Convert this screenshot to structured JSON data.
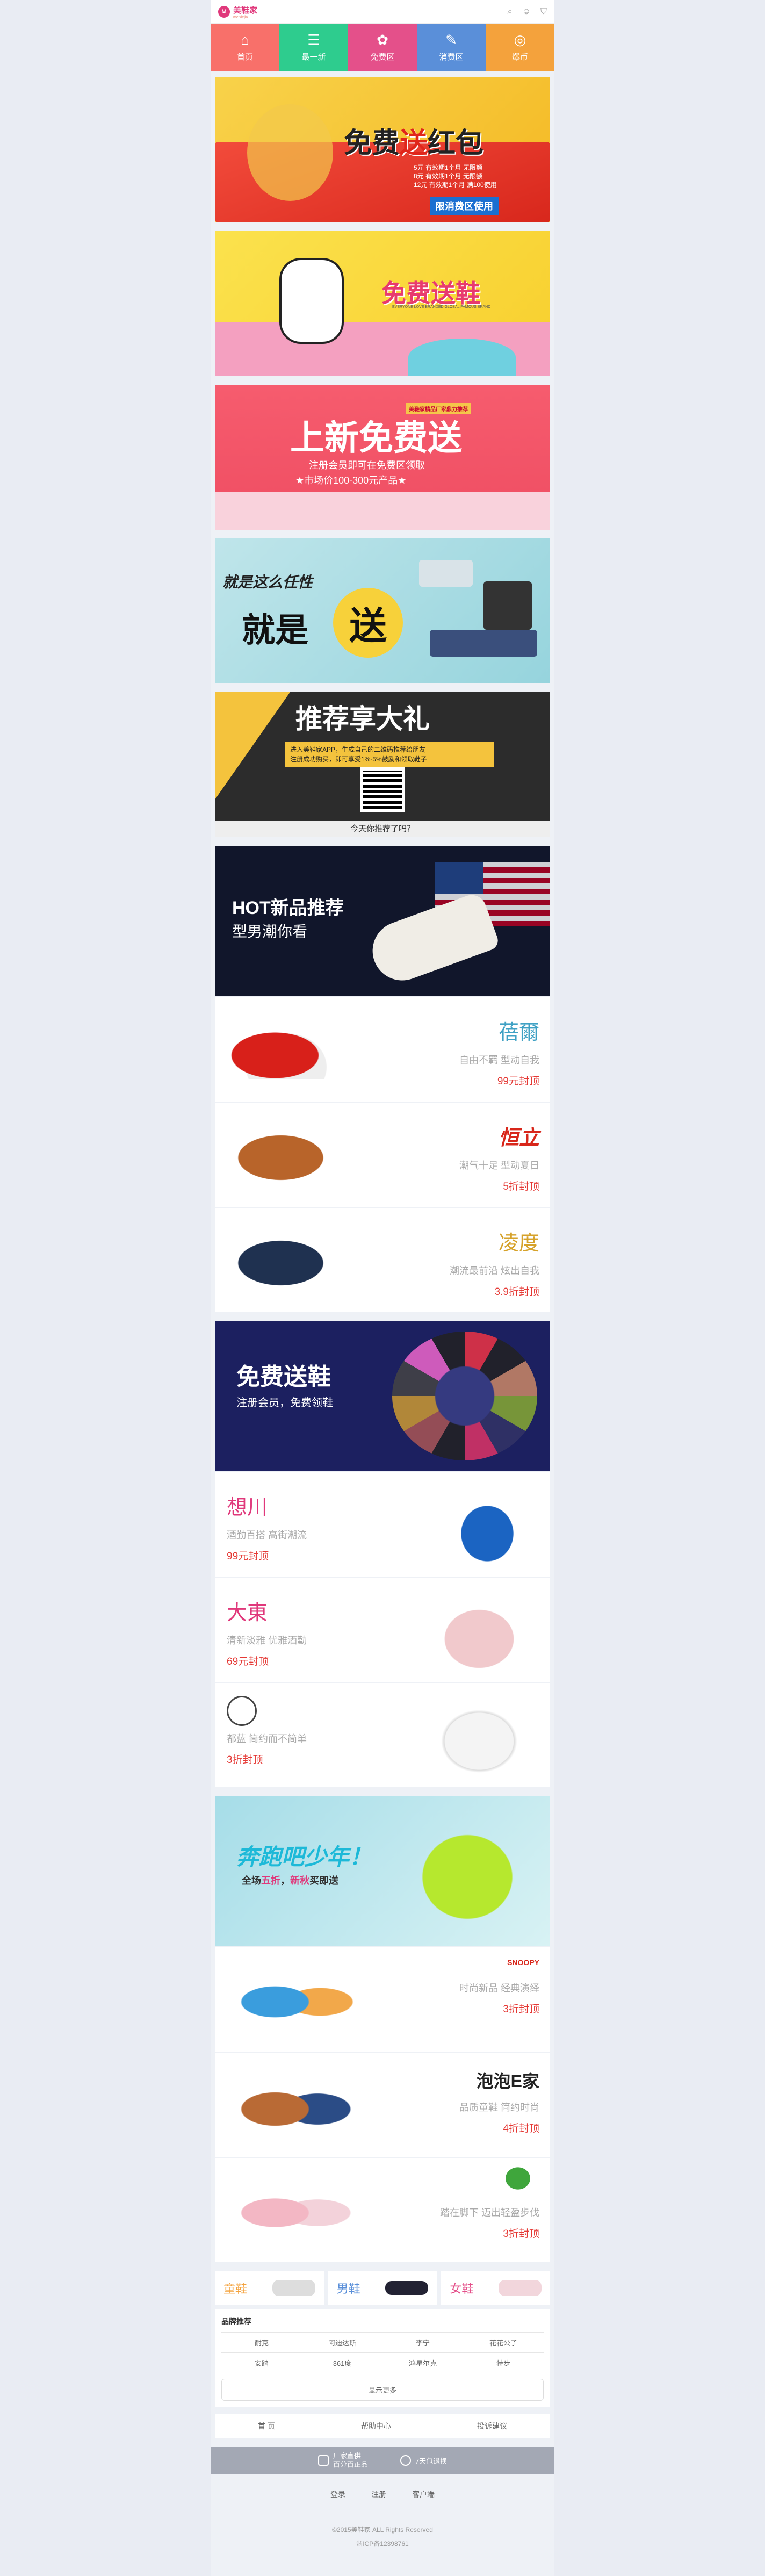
{
  "header": {
    "logo_text": "美鞋家",
    "logo_sub": "meixiejia",
    "logo_mark": "M"
  },
  "nav": [
    {
      "label": "首页",
      "icon": "⌂",
      "color": "#f8706a"
    },
    {
      "label": "最一新",
      "icon": "☰",
      "color": "#2ecc8e"
    },
    {
      "label": "免费区",
      "icon": "✿",
      "color": "#e4508a"
    },
    {
      "label": "消费区",
      "icon": "✎",
      "color": "#5a8fd9"
    },
    {
      "label": "爆币",
      "icon": "◎",
      "color": "#f4a23c"
    }
  ],
  "banners": {
    "b1": {
      "title_a": "免费",
      "title_b": "送",
      "title_c": "红包",
      "sub": "限消费区使用",
      "lines": [
        "5元 有效期1个月 无限额",
        "8元 有效期1个月 无限额",
        "12元 有效期1个月 满100使用"
      ]
    },
    "b2": {
      "title": "免费送鞋",
      "sub": "EVERYONE LOVE BRANDED GLOBAL FAMOUS BRAND"
    },
    "b3": {
      "tag": "美鞋家精品厂家鼎力推荐",
      "title": "上新免费送",
      "line1": "注册会员即可在免费区领取",
      "line2": "★市场价100-300元产品★"
    },
    "b4": {
      "small": "就是这么任性",
      "big": "就是",
      "circle": "送"
    },
    "b5": {
      "title": "推荐享大礼",
      "l1": "进入美鞋家APP，生成自己的二维码推荐给朋友",
      "l2": "注册成功购买，即可享受1%-5%鼓励和领取鞋子",
      "foot": "今天你推荐了吗？"
    }
  },
  "section1": {
    "hero_title": "HOT新品推荐",
    "hero_sub": "型男潮你看",
    "rows": [
      {
        "brand": "蓓爾",
        "desc": "自由不羁 型动自我",
        "price": "99元封顶",
        "brand_color": "#3fa1c4"
      },
      {
        "brand": "恒立",
        "desc": "潮气十足 型动夏日",
        "price": "5折封顶",
        "brand_color": "#d8261a"
      },
      {
        "brand": "凌度",
        "desc": "潮流最前沿 炫出自我",
        "price": "3.9折封顶",
        "brand_color": "#d6a22a"
      }
    ]
  },
  "section2": {
    "hero_title": "免费送鞋",
    "hero_sub": "注册会员，免费领鞋",
    "rows": [
      {
        "brand": "想川",
        "desc": "酒勤百搭 高街潮流",
        "price": "99元封顶",
        "brand_color": "#e0387b"
      },
      {
        "brand": "大東",
        "desc": "清新淡雅 优雅酒勤",
        "price": "69元封顶",
        "brand_color": "#e0387b"
      },
      {
        "brand": "",
        "desc": "都蓝 简约而不简单",
        "price": "3折封顶",
        "brand_color": "#333"
      }
    ]
  },
  "section3": {
    "hero_title": "奔跑吧少年！",
    "hero_sub_a": "全场",
    "hero_sub_b": "五折",
    "hero_sub_c": "，",
    "hero_sub_d": "新秋",
    "hero_sub_e": "买即送",
    "rows": [
      {
        "brand": "SNOOPY",
        "desc": "时尚新品 经典演绎",
        "price": "3折封顶",
        "brand_color": "#d8261a"
      },
      {
        "brand": "泡泡E家",
        "desc": "品质童鞋 简约时尚",
        "price": "4折封顶",
        "brand_color": "#222"
      },
      {
        "brand": "",
        "desc": "踏在脚下 迈出轻盈步伐",
        "price": "3折封顶",
        "brand_color": "#333"
      }
    ]
  },
  "cats": [
    {
      "label": "童鞋",
      "color": "#f4a23c"
    },
    {
      "label": "男鞋",
      "color": "#5a8fd9"
    },
    {
      "label": "女鞋",
      "color": "#e4508a"
    }
  ],
  "brands": {
    "title": "品牌推荐",
    "items": [
      "耐克",
      "阿迪达斯",
      "李宁",
      "花花公子",
      "安踏",
      "361度",
      "鸿星尔克",
      "特步"
    ],
    "more": "显示更多"
  },
  "footnav": [
    "首 页",
    "帮助中心",
    "投诉建议"
  ],
  "graybar": {
    "a_line1": "厂家直供",
    "a_line2": "百分百正品",
    "b": "7天包退换"
  },
  "links": [
    "登录",
    "注册",
    "客户端"
  ],
  "copy": {
    "line1": "©2015美鞋家 ALL Rights Reserved",
    "line2": "浙ICP备12398761"
  }
}
